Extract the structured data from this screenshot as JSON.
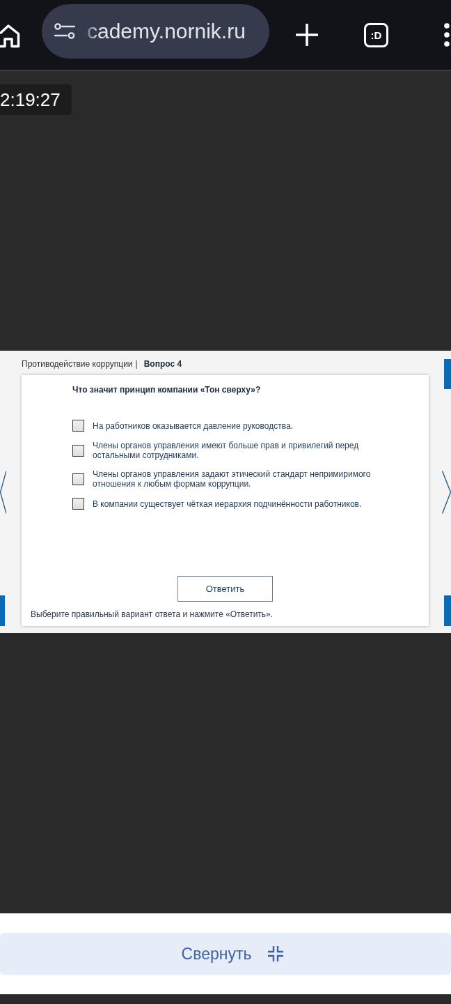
{
  "browser": {
    "url": "cademy.nornik.ru",
    "tab_count": ":D"
  },
  "timer": "2:19:27",
  "quiz": {
    "course": "Противодействие коррупции",
    "separator": "|",
    "question_number": "Вопрос 4",
    "question": "Что значит принцип компании «Тон сверху»?",
    "options": [
      {
        "label": "На работников оказывается давление руководства.",
        "checked": false
      },
      {
        "label": "Члены органов управления имеют больше прав и привилегий перед остальными сотрудниками.",
        "checked": false
      },
      {
        "label": "Члены органов управления задают этический стандарт непримиримого отношения к любым формам коррупции.",
        "checked": false
      },
      {
        "label": "В компании существует чёткая иерархия подчинённости работников.",
        "checked": false
      }
    ],
    "submit_button": "Ответить",
    "hint": "Выберите правильный вариант ответа и нажмите «Ответить»."
  },
  "collapse_button": "Свернуть"
}
